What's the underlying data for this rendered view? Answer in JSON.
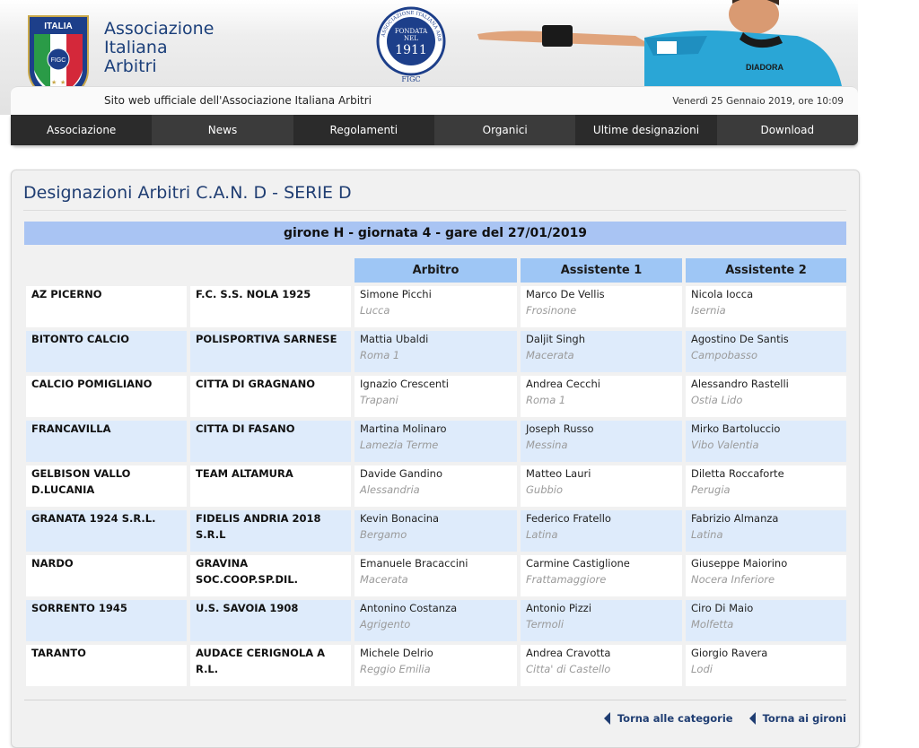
{
  "header": {
    "site_name_lines": [
      "Associazione",
      "Italiana",
      "Arbitri"
    ],
    "logo_text_italia": "ITALIA",
    "logo_text_figc": "FIGC",
    "seal": {
      "ring_text": "ASSOCIAZIONE ITALIANA ARBITRI",
      "fondata": "FONDATA",
      "nel": "NEL",
      "year": "1911",
      "figc": "FIGC"
    },
    "tagline": "Sito web ufficiale dell'Associazione Italiana Arbitri",
    "date": "Venerdì 25 Gennaio 2019, ore 10:09",
    "referee_shirt_brand": "DIADORA"
  },
  "nav": {
    "items": [
      "Associazione",
      "News",
      "Regolamenti",
      "Organici",
      "Ultime designazioni",
      "Download"
    ]
  },
  "main": {
    "title": "Designazioni Arbitri C.A.N. D - SERIE D",
    "girone": "girone H - giornata 4 - gare del 27/01/2019",
    "columns": [
      "Arbitro",
      "Assistente 1",
      "Assistente 2"
    ],
    "matches": [
      {
        "home": "AZ PICERNO",
        "away": "F.C. S.S. NOLA 1925",
        "arbitro": {
          "name": "Simone Picchi",
          "city": "Lucca"
        },
        "ass1": {
          "name": "Marco De Vellis",
          "city": "Frosinone"
        },
        "ass2": {
          "name": "Nicola Iocca",
          "city": "Isernia"
        }
      },
      {
        "home": "BITONTO CALCIO",
        "away": "POLISPORTIVA SARNESE",
        "arbitro": {
          "name": "Mattia Ubaldi",
          "city": "Roma 1"
        },
        "ass1": {
          "name": "Daljit Singh",
          "city": "Macerata"
        },
        "ass2": {
          "name": "Agostino De Santis",
          "city": "Campobasso"
        }
      },
      {
        "home": "CALCIO POMIGLIANO",
        "away": "CITTA DI GRAGNANO",
        "arbitro": {
          "name": "Ignazio Crescenti",
          "city": "Trapani"
        },
        "ass1": {
          "name": "Andrea Cecchi",
          "city": "Roma 1"
        },
        "ass2": {
          "name": "Alessandro Rastelli",
          "city": "Ostia Lido"
        }
      },
      {
        "home": "FRANCAVILLA",
        "away": "CITTA DI FASANO",
        "arbitro": {
          "name": "Martina Molinaro",
          "city": "Lamezia Terme"
        },
        "ass1": {
          "name": "Joseph Russo",
          "city": "Messina"
        },
        "ass2": {
          "name": "Mirko Bartoluccio",
          "city": "Vibo Valentia"
        }
      },
      {
        "home": "GELBISON VALLO D.LUCANIA",
        "away": "TEAM ALTAMURA",
        "arbitro": {
          "name": "Davide Gandino",
          "city": "Alessandria"
        },
        "ass1": {
          "name": "Matteo Lauri",
          "city": "Gubbio"
        },
        "ass2": {
          "name": "Diletta Roccaforte",
          "city": "Perugia"
        }
      },
      {
        "home": "GRANATA 1924 S.R.L.",
        "away": "FIDELIS ANDRIA 2018 S.R.L",
        "arbitro": {
          "name": "Kevin Bonacina",
          "city": "Bergamo"
        },
        "ass1": {
          "name": "Federico Fratello",
          "city": "Latina"
        },
        "ass2": {
          "name": "Fabrizio Almanza",
          "city": "Latina"
        }
      },
      {
        "home": "NARDO",
        "away": "GRAVINA SOC.COOP.SP.DIL.",
        "arbitro": {
          "name": "Emanuele Bracaccini",
          "city": "Macerata"
        },
        "ass1": {
          "name": "Carmine Castiglione",
          "city": "Frattamaggiore"
        },
        "ass2": {
          "name": "Giuseppe Maiorino",
          "city": "Nocera Inferiore"
        }
      },
      {
        "home": "SORRENTO 1945",
        "away": "U.S. SAVOIA 1908",
        "arbitro": {
          "name": "Antonino Costanza",
          "city": "Agrigento"
        },
        "ass1": {
          "name": "Antonio Pizzi",
          "city": "Termoli"
        },
        "ass2": {
          "name": "Ciro Di Maio",
          "city": "Molfetta"
        }
      },
      {
        "home": "TARANTO",
        "away": "AUDACE CERIGNOLA A R.L.",
        "arbitro": {
          "name": "Michele Delrio",
          "city": "Reggio Emilia"
        },
        "ass1": {
          "name": "Andrea Cravotta",
          "city": "Citta' di Castello"
        },
        "ass2": {
          "name": "Giorgio Ravera",
          "city": "Lodi"
        }
      }
    ]
  },
  "footer": {
    "back_categories": "Torna alle categorie",
    "back_gironi": "Torna ai gironi"
  },
  "colors": {
    "brand_blue": "#1f3d72",
    "girone_bar": "#a9c4f3",
    "column_header": "#9ec6f5",
    "row_alt": "#deebfb",
    "nav_bg": "#3b3b3b"
  }
}
